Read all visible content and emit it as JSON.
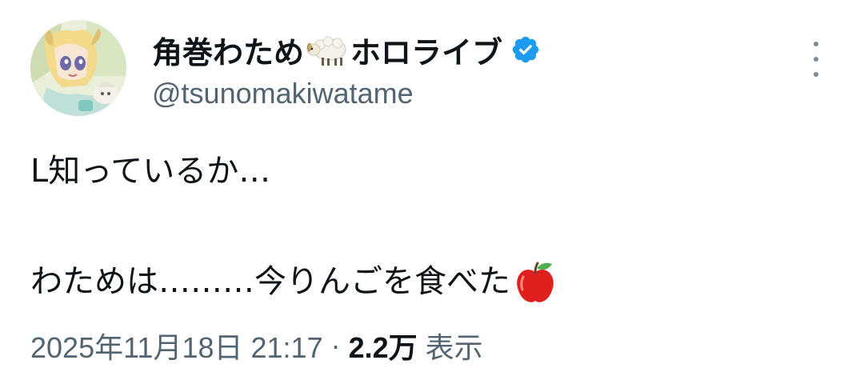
{
  "author": {
    "display_name_part1": "角巻わため",
    "display_name_part2": "ホロライブ",
    "sheep_emoji": "sheep-emoji",
    "verified_icon": "verified-badge-icon",
    "handle": "@tsunomakiwatame"
  },
  "more_icon": "more-options-icon",
  "tweet": {
    "line1": "L知っているか…",
    "line2": "わためは………今りんごを食べた",
    "apple_emoji": "red-apple-emoji"
  },
  "meta": {
    "timestamp": "2025年11月18日 21:17",
    "separator": "·",
    "views_count": "2.2万",
    "views_label": "表示"
  },
  "colors": {
    "text_primary": "#0f1419",
    "text_secondary": "#536471",
    "verified_blue": "#1d9bf0"
  }
}
